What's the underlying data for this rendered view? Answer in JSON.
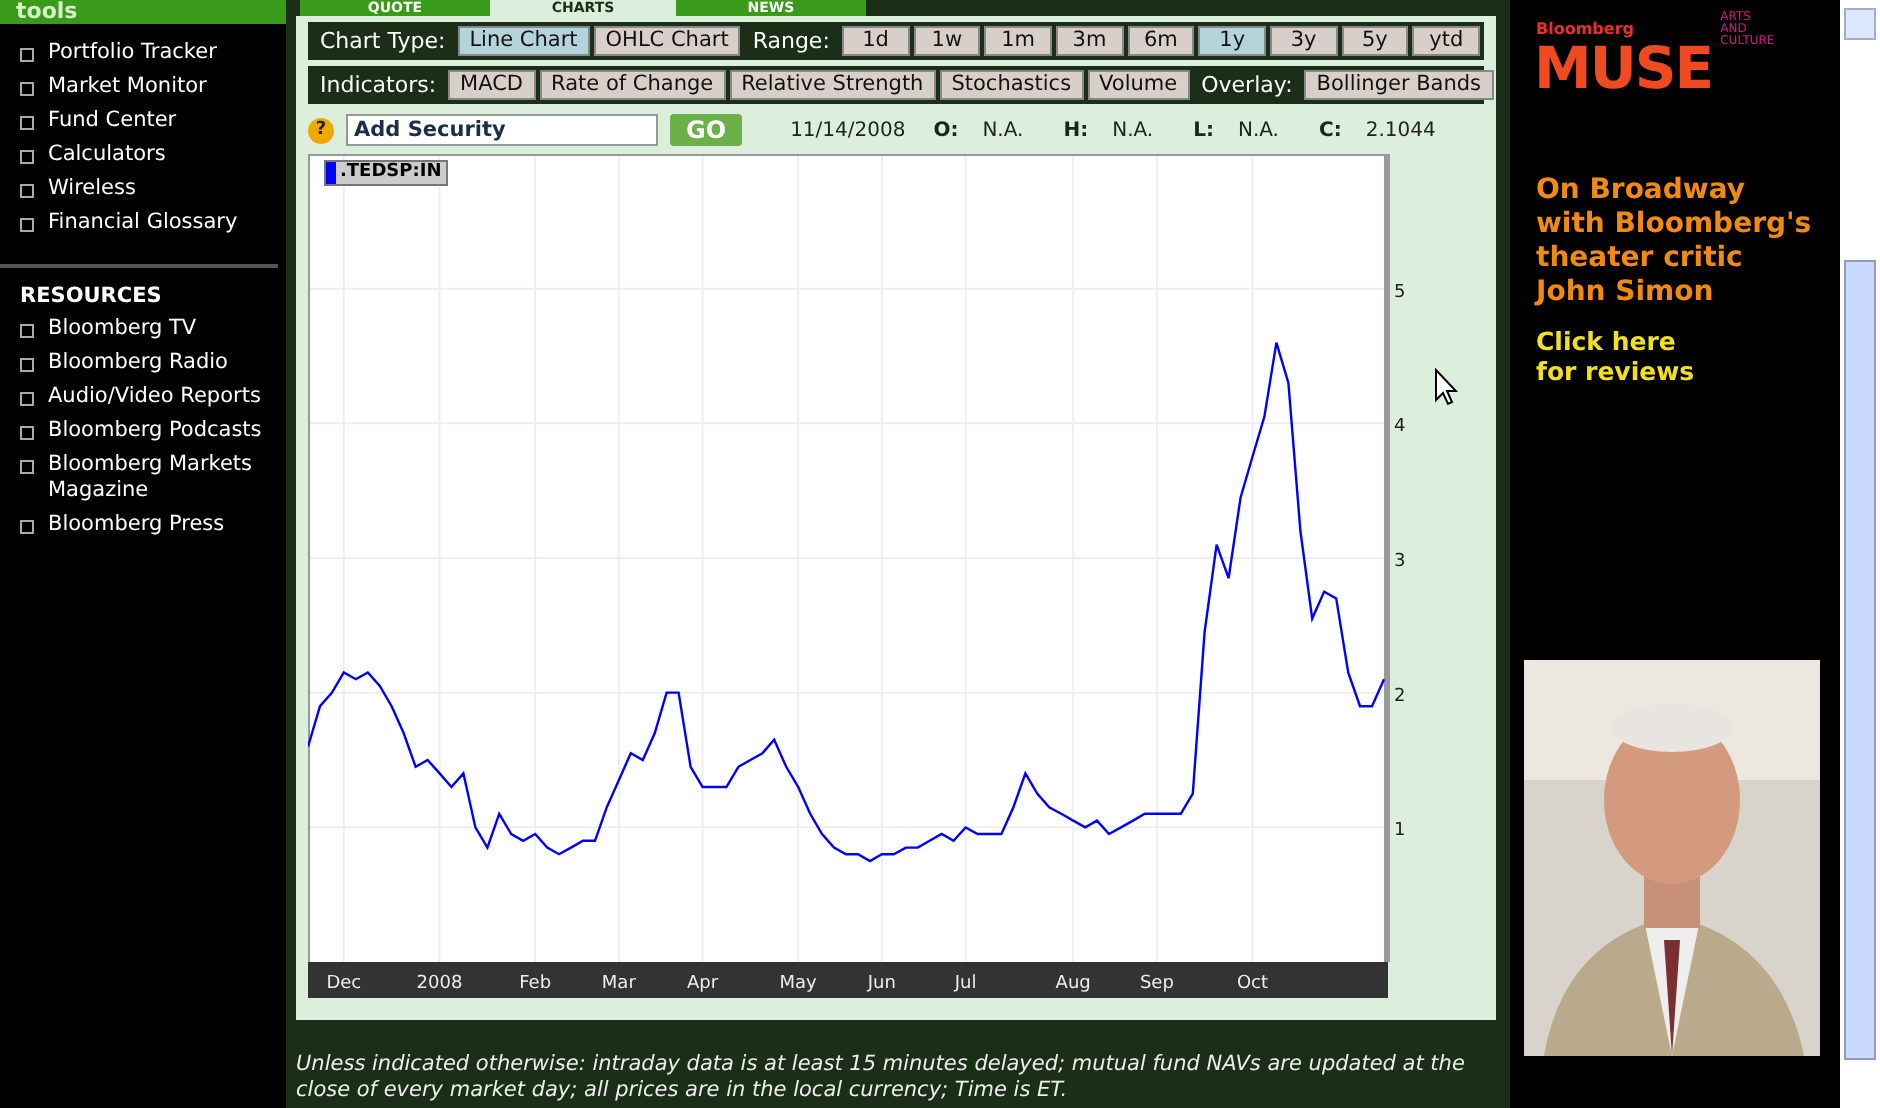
{
  "sidebar": {
    "header": "tools",
    "items": [
      "Portfolio Tracker",
      "Market Monitor",
      "Fund Center",
      "Calculators",
      "Wireless",
      "Financial Glossary"
    ],
    "section_title": "RESOURCES",
    "resources": [
      "Bloomberg TV",
      "Bloomberg Radio",
      "Audio/Video Reports",
      "Bloomberg Podcasts",
      "Bloomberg Markets Magazine",
      "Bloomberg Press"
    ]
  },
  "tabs": [
    {
      "label": "QUOTE",
      "selected": false
    },
    {
      "label": "CHARTS",
      "selected": true
    },
    {
      "label": "NEWS",
      "selected": false
    }
  ],
  "chart_type": {
    "label": "Chart Type:",
    "options": [
      {
        "label": "Line Chart",
        "selected": true
      },
      {
        "label": "OHLC Chart",
        "selected": false
      }
    ]
  },
  "range": {
    "label": "Range:",
    "options": [
      {
        "label": "1d",
        "selected": false
      },
      {
        "label": "1w",
        "selected": false
      },
      {
        "label": "1m",
        "selected": false
      },
      {
        "label": "3m",
        "selected": false
      },
      {
        "label": "6m",
        "selected": false
      },
      {
        "label": "1y",
        "selected": true
      },
      {
        "label": "3y",
        "selected": false
      },
      {
        "label": "5y",
        "selected": false
      },
      {
        "label": "ytd",
        "selected": false
      }
    ]
  },
  "indicators": {
    "label": "Indicators:",
    "options": [
      {
        "label": "MACD",
        "selected": false
      },
      {
        "label": "Rate of Change",
        "selected": false
      },
      {
        "label": "Relative Strength",
        "selected": false
      },
      {
        "label": "Stochastics",
        "selected": false
      },
      {
        "label": "Volume",
        "selected": false
      }
    ]
  },
  "overlay": {
    "label": "Overlay:",
    "options": [
      {
        "label": "Bollinger Bands",
        "selected": false
      }
    ]
  },
  "security": {
    "help": "?",
    "value": "Add Security",
    "go": "GO"
  },
  "quote": {
    "date": "11/14/2008",
    "fields": [
      {
        "label": "O:",
        "value": "N.A."
      },
      {
        "label": "H:",
        "value": "N.A."
      },
      {
        "label": "L:",
        "value": "N.A."
      },
      {
        "label": "C:",
        "value": "2.1044"
      }
    ]
  },
  "chart": {
    "chart_data": {
      "type": "line",
      "grid": true,
      "ylim": [
        0,
        6
      ],
      "yticks": [
        1,
        2,
        3,
        4,
        5
      ],
      "categories": [
        null,
        null,
        null,
        "Dec",
        null,
        null,
        null,
        null,
        null,
        null,
        null,
        "2008",
        null,
        null,
        null,
        null,
        null,
        null,
        null,
        "Feb",
        null,
        null,
        null,
        null,
        null,
        null,
        "Mar",
        null,
        null,
        null,
        null,
        null,
        null,
        "Apr",
        null,
        null,
        null,
        null,
        null,
        null,
        null,
        "May",
        null,
        null,
        null,
        null,
        null,
        null,
        "Jun",
        null,
        null,
        null,
        null,
        null,
        null,
        "Jul",
        null,
        null,
        null,
        null,
        null,
        null,
        null,
        null,
        "Aug",
        null,
        null,
        null,
        null,
        null,
        null,
        "Sep",
        null,
        null,
        null,
        null,
        null,
        null,
        null,
        "Oct",
        null,
        null,
        null,
        null,
        null,
        null,
        null,
        null,
        null,
        null,
        null
      ],
      "series": [
        {
          "name": ".TEDSP:IN",
          "color": "#0000ff",
          "values": [
            1.6,
            1.9,
            2.0,
            2.15,
            2.1,
            2.15,
            2.05,
            1.9,
            1.7,
            1.45,
            1.5,
            1.4,
            1.3,
            1.4,
            1.0,
            0.85,
            1.1,
            0.95,
            0.9,
            0.95,
            0.85,
            0.8,
            0.85,
            0.9,
            0.9,
            1.15,
            1.35,
            1.55,
            1.5,
            1.7,
            2.0,
            2.0,
            1.45,
            1.3,
            1.3,
            1.3,
            1.45,
            1.5,
            1.55,
            1.65,
            1.45,
            1.3,
            1.1,
            0.95,
            0.85,
            0.8,
            0.8,
            0.75,
            0.8,
            0.8,
            0.85,
            0.85,
            0.9,
            0.95,
            0.9,
            1.0,
            0.95,
            0.95,
            0.95,
            1.15,
            1.4,
            1.25,
            1.15,
            1.1,
            1.05,
            1.0,
            1.05,
            0.95,
            1.0,
            1.05,
            1.1,
            1.1,
            1.1,
            1.1,
            1.25,
            2.45,
            3.1,
            2.85,
            3.45,
            3.75,
            4.05,
            4.6,
            4.3,
            3.2,
            2.55,
            2.75,
            2.7,
            2.15,
            1.9,
            1.9,
            2.1
          ]
        }
      ]
    }
  },
  "footnote": "Unless indicated otherwise: intraday data is at least 15 minutes delayed; mutual fund NAVs are updated at the close of every market day; all prices are in the local currency; Time is ET.",
  "ad": {
    "brand": "Bloomberg",
    "title": "MUSE",
    "tagline": [
      "ARTS",
      "AND",
      "CULTURE"
    ],
    "headline": "On Broadway with Bloomberg's theater critic John Simon",
    "cta": "Click here for reviews",
    "photo": {
      "kind": "picture"
    }
  }
}
